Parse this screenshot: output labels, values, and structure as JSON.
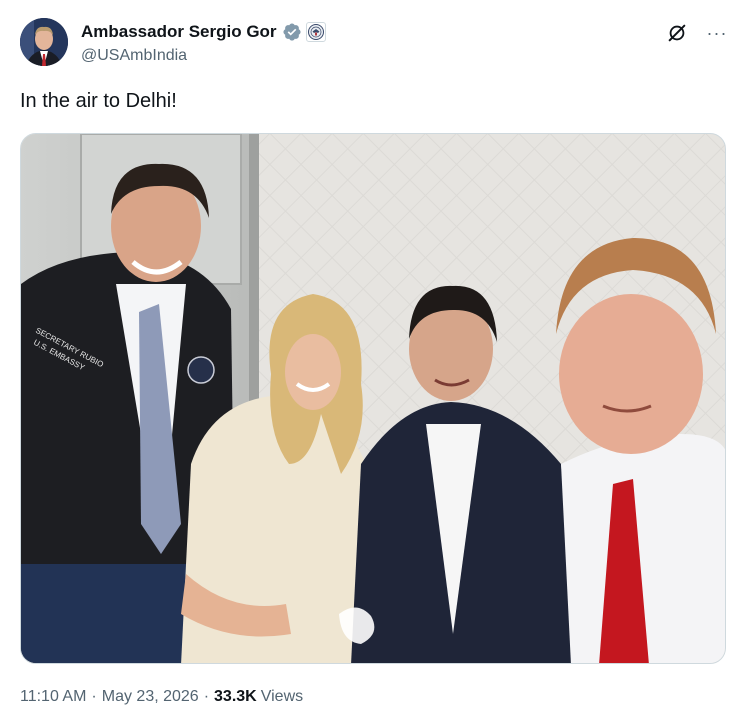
{
  "author": {
    "display_name": "Ambassador Sergio Gor",
    "handle": "@USAmbIndia",
    "verified_badge_icon": "verified-check-icon",
    "affiliate_badge_icon": "state-department-seal-icon",
    "verified_color": "#829aab"
  },
  "actions": {
    "grok_icon": "grok-icon",
    "more_icon": "more-horizontal-icon",
    "more_label": "···"
  },
  "tweet": {
    "text": "In the air to Delhi!"
  },
  "media": {
    "type": "photo",
    "jacket_text_line1": "SECRETARY RUBIO",
    "jacket_text_line2": "U.S. EMBASSY"
  },
  "meta": {
    "time": "11:10 AM",
    "separator": "·",
    "date": "May 23, 2026",
    "views_count": "33.3K",
    "views_label": "Views"
  }
}
